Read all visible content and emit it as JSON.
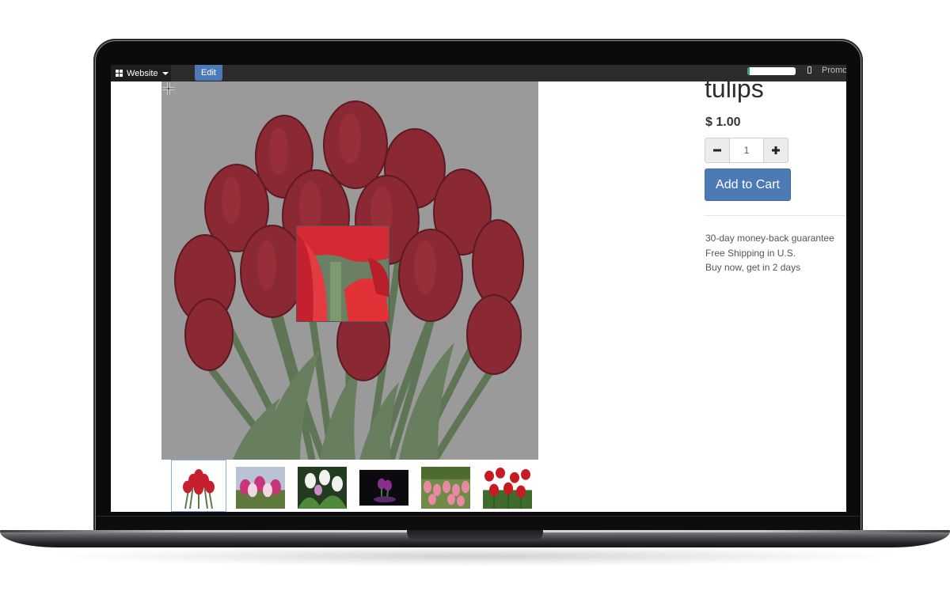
{
  "navbar": {
    "website_label": "Website",
    "edit_label": "Edit",
    "progress_fraction": 0.05,
    "promote_label": "Promote"
  },
  "product": {
    "title": "tulips",
    "price": "$ 1.00",
    "quantity": "1",
    "add_to_cart_label": "Add to Cart",
    "perks": [
      "30-day money-back guarantee",
      "Free Shipping in U.S.",
      "Buy now, get in 2 days"
    ]
  },
  "gallery": {
    "active_index": 0,
    "thumbnails": [
      {
        "name": "red-tulips-thumbnail",
        "icon": "red-tulip-bouquet"
      },
      {
        "name": "pink-tulips-thumbnail",
        "icon": "pink-white-tulips"
      },
      {
        "name": "white-tulips-thumbnail",
        "icon": "white-tulips-green-leaves"
      },
      {
        "name": "purple-tulips-thumbnail",
        "icon": "purple-tulips-black-background"
      },
      {
        "name": "pink-field-thumbnail",
        "icon": "pink-tulip-field"
      },
      {
        "name": "red-field-thumbnail",
        "icon": "red-tulip-field"
      }
    ]
  },
  "colors": {
    "accent": "#4c7ab5",
    "navbar": "#2c2c2c",
    "tulip_red": "#8e2a35",
    "stem_green": "#6f8a66"
  }
}
